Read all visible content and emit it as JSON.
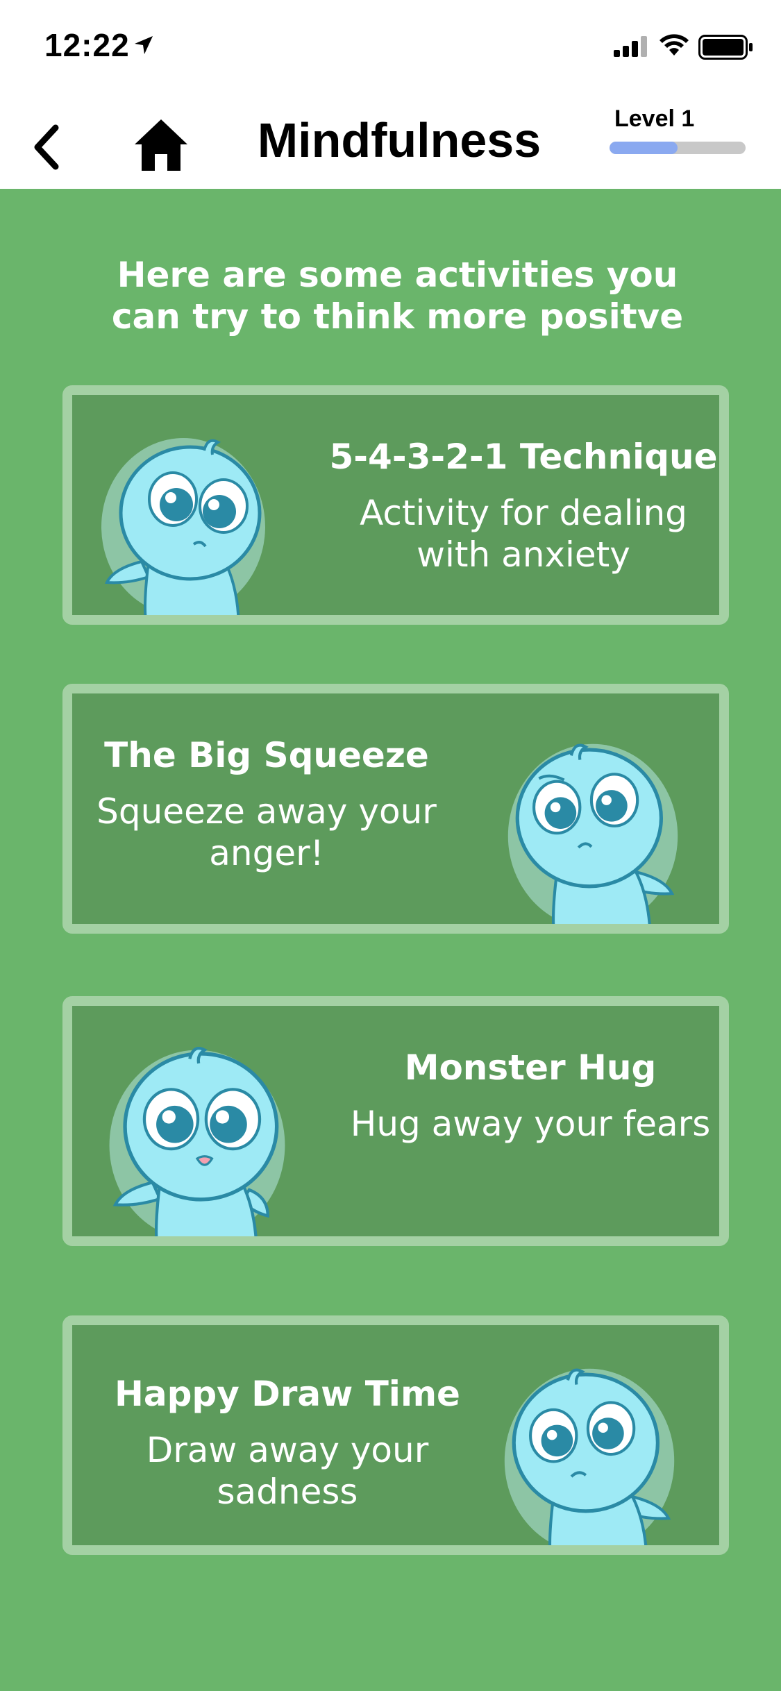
{
  "status": {
    "time": "12:22"
  },
  "nav": {
    "title": "Mindfulness",
    "level_label": "Level 1",
    "level_progress": 0.5
  },
  "intro": "Here are some activities you can try to think more positve",
  "activities": [
    {
      "title": "5-4-3-2-1 Technique",
      "description": "Activity for dealing with anxiety"
    },
    {
      "title": "The Big Squeeze",
      "description": "Squeeze away your anger!"
    },
    {
      "title": "Monster Hug",
      "description": "Hug away your fears"
    },
    {
      "title": "Happy Draw Time",
      "description": "Draw away your sadness"
    }
  ],
  "colors": {
    "background": "#6ab56b",
    "card": "#5d9b5c",
    "card_border": "#a4d1a4",
    "progress_fill": "#8aa9f0",
    "monster": "#a8f0f8"
  },
  "icons": {
    "back": "chevron-left-icon",
    "home": "home-icon",
    "location": "location-arrow-icon",
    "signal": "cellular-signal-icon",
    "wifi": "wifi-icon",
    "battery": "battery-icon"
  }
}
